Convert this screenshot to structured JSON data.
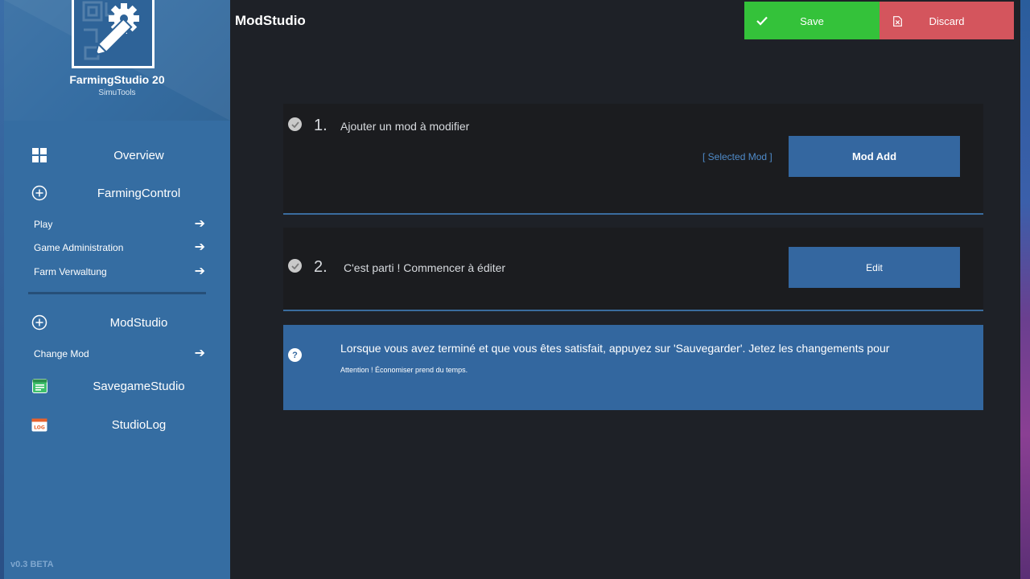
{
  "app": {
    "name": "FarmingStudio 20",
    "vendor": "SimuTools",
    "version": "v0.3 BETA"
  },
  "sidebar": {
    "overview": "Overview",
    "farming_control": "FarmingControl",
    "farming_items": [
      {
        "label": "Play"
      },
      {
        "label": "Game Administration"
      },
      {
        "label": "Farm Verwaltung"
      }
    ],
    "mod_studio": "ModStudio",
    "mod_items": [
      {
        "label": "Change Mod"
      }
    ],
    "savegame_studio": "SavegameStudio",
    "studio_log": "StudioLog",
    "log_icon_text": "LOG"
  },
  "header": {
    "title": "ModStudio",
    "save_label": "Save",
    "discard_label": "Discard"
  },
  "steps": [
    {
      "number": "1.",
      "text": "Ajouter un mod à modifier",
      "status": "[ Selected Mod ]",
      "button": "Mod Add"
    },
    {
      "number": "2.",
      "text": "C'est parti ! Commencer à éditer",
      "button": "Edit"
    }
  ],
  "info": {
    "message": "Lorsque vous avez terminé et que vous êtes satisfait, appuyez sur 'Sauvegarder'. Jetez les changements pour",
    "note": "Attention ! Économiser prend du temps."
  },
  "colors": {
    "sidebar": "#356da2",
    "main_bg": "#1e2127",
    "card_bg": "#1b1c1f",
    "accent_blue": "#3467a0",
    "save_green": "#34c23a",
    "discard_red": "#d4555d",
    "selected_mod_text": "#4f8bc9"
  }
}
